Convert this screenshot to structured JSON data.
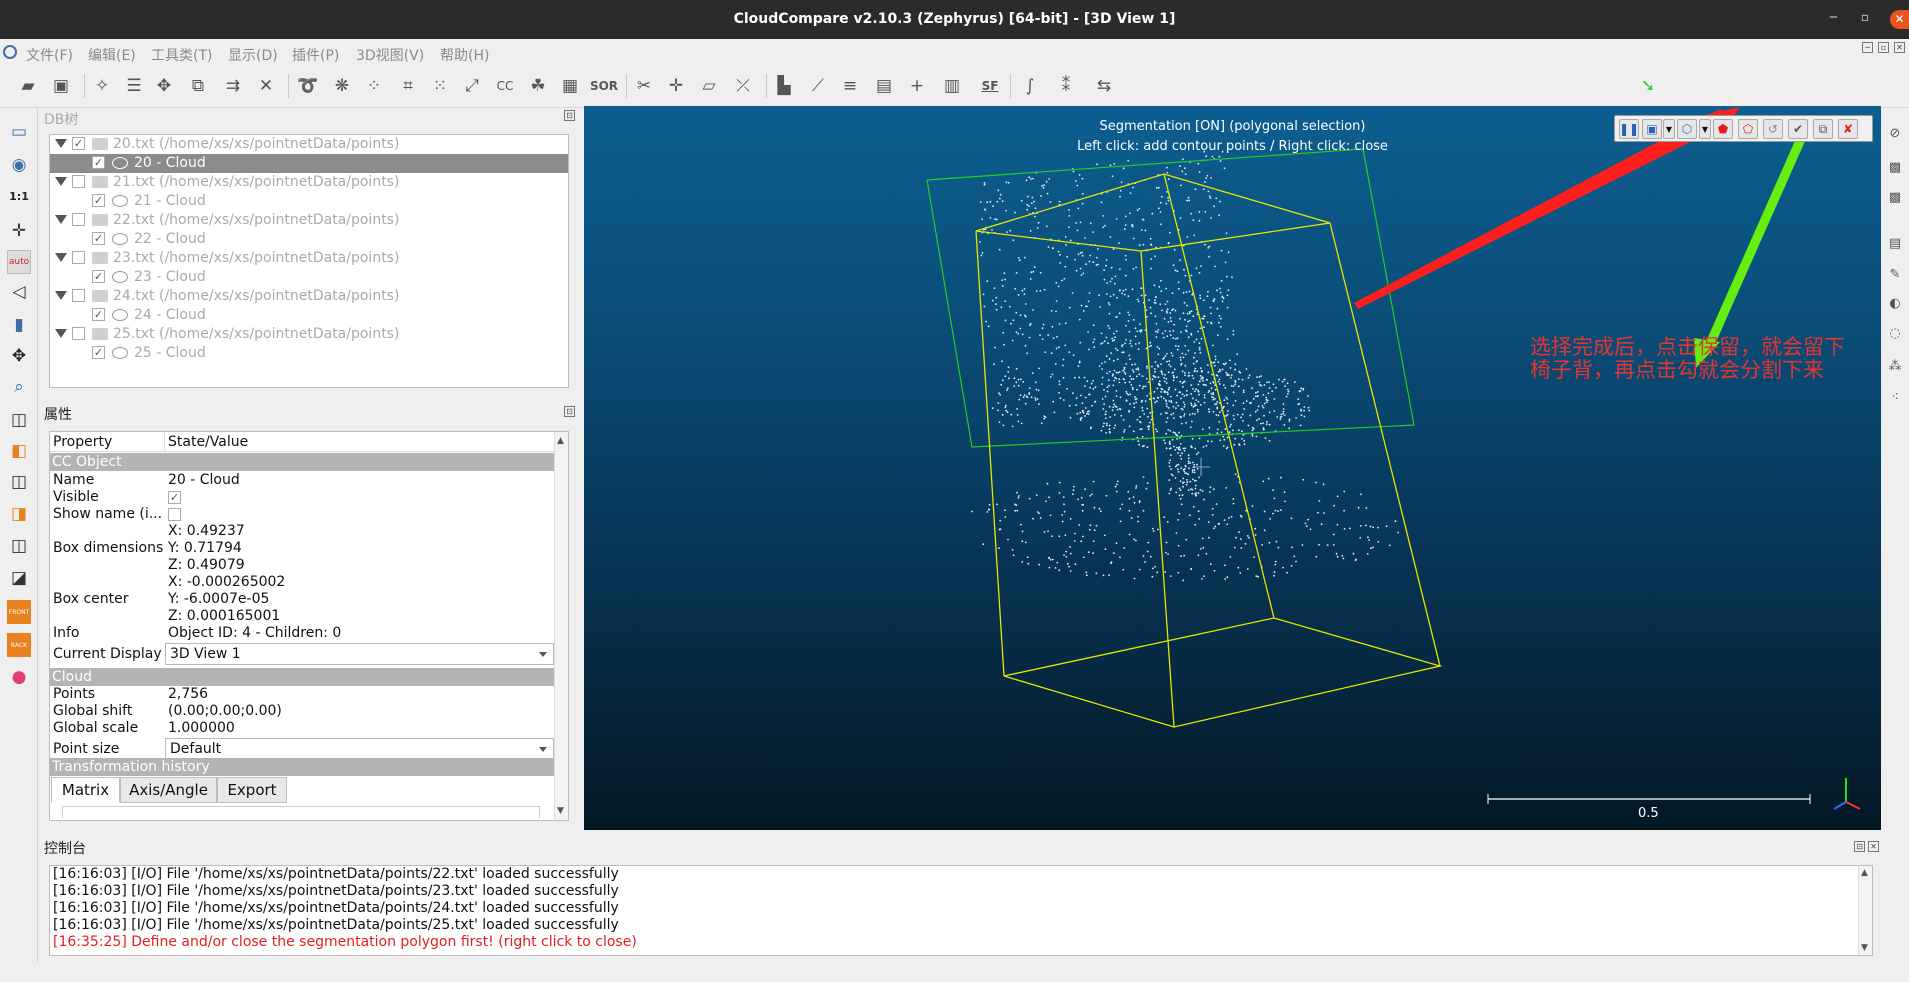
{
  "window": {
    "title": "CloudCompare v2.10.3 (Zephyrus) [64-bit] - [3D View 1]"
  },
  "menu": [
    "文件(F)",
    "编辑(E)",
    "工具类(T)",
    "显示(D)",
    "插件(P)",
    "3D视图(V)",
    "帮助(H)"
  ],
  "toolbar": {
    "sor_label": "SOR",
    "sf_label": "SF",
    "cc_label": "CC"
  },
  "left_tools": {
    "scale_label": "1:1",
    "auto_label": "auto",
    "front_label": "FRONT",
    "back_label": "BACK"
  },
  "dbtree": {
    "title": "DB树",
    "items": [
      {
        "label": "20.txt (/home/xs/xs/pointnetData/points)",
        "level": 0,
        "checked": true
      },
      {
        "label": "20 - Cloud",
        "level": 1,
        "checked": true,
        "selected": true
      },
      {
        "label": "21.txt (/home/xs/xs/pointnetData/points)",
        "level": 0,
        "checked": false
      },
      {
        "label": "21 - Cloud",
        "level": 1,
        "checked": true
      },
      {
        "label": "22.txt (/home/xs/xs/pointnetData/points)",
        "level": 0,
        "checked": false
      },
      {
        "label": "22 - Cloud",
        "level": 1,
        "checked": true
      },
      {
        "label": "23.txt (/home/xs/xs/pointnetData/points)",
        "level": 0,
        "checked": false
      },
      {
        "label": "23 - Cloud",
        "level": 1,
        "checked": true
      },
      {
        "label": "24.txt (/home/xs/xs/pointnetData/points)",
        "level": 0,
        "checked": false
      },
      {
        "label": "24 - Cloud",
        "level": 1,
        "checked": true
      },
      {
        "label": "25.txt (/home/xs/xs/pointnetData/points)",
        "level": 0,
        "checked": false
      },
      {
        "label": "25 - Cloud",
        "level": 1,
        "checked": true
      }
    ]
  },
  "properties": {
    "title": "属性",
    "col_property": "Property",
    "col_value": "State/Value",
    "section_ccobject": "CC Object",
    "name_key": "Name",
    "name_val": "20 - Cloud",
    "visible_key": "Visible",
    "showname_key": "Show name (i...",
    "boxdim_key": "Box dimensions",
    "boxdim_x": "X: 0.49237",
    "boxdim_y": "Y: 0.71794",
    "boxdim_z": "Z: 0.49079",
    "boxcenter_key": "Box center",
    "boxcenter_x": "X: -0.000265002",
    "boxcenter_y": "Y: -6.0007e-05",
    "boxcenter_z": "Z: 0.000165001",
    "info_key": "Info",
    "info_val": "Object ID: 4 - Children: 0",
    "display_key": "Current Display",
    "display_val": "3D View 1",
    "section_cloud": "Cloud",
    "points_key": "Points",
    "points_val": "2,756",
    "gshift_key": "Global shift",
    "gshift_val": "(0.00;0.00;0.00)",
    "gscale_key": "Global scale",
    "gscale_val": "1.000000",
    "psize_key": "Point size",
    "psize_val": "Default",
    "section_transform": "Transformation history",
    "tabs": [
      "Matrix",
      "Axis/Angle",
      "Export"
    ]
  },
  "view3d": {
    "seg_line1": "Segmentation [ON] (polygonal selection)",
    "seg_line2": "Left click: add contour points / Right click: close",
    "annotation_line1": "选择完成后，点击保留，就会留下",
    "annotation_line2": "椅子背，再点击勾就会分割下来",
    "scale_label": "0.5",
    "colors": {
      "box": "#e6e600",
      "polygon": "#22cc22",
      "arrow_red": "#ff1e1e",
      "arrow_green": "#66ee11",
      "points": "#e8eef5"
    }
  },
  "console": {
    "title": "控制台",
    "lines": [
      {
        "text": "[16:16:03] [I/O] File '/home/xs/xs/pointnetData/points/22.txt' loaded successfully",
        "error": false
      },
      {
        "text": "[16:16:03] [I/O] File '/home/xs/xs/pointnetData/points/23.txt' loaded successfully",
        "error": false
      },
      {
        "text": "[16:16:03] [I/O] File '/home/xs/xs/pointnetData/points/24.txt' loaded successfully",
        "error": false
      },
      {
        "text": "[16:16:03] [I/O] File '/home/xs/xs/pointnetData/points/25.txt' loaded successfully",
        "error": false
      },
      {
        "text": "[16:35:25] Define and/or close the segmentation polygon first! (right click to close)",
        "error": true
      }
    ]
  }
}
